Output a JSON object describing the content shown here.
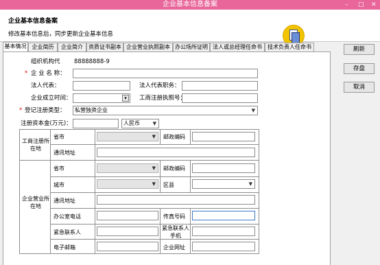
{
  "window": {
    "title": "企业基本信息备案",
    "controls": [
      "–",
      "□",
      "✕"
    ]
  },
  "header": {
    "title": "企业基本信息备案",
    "subtitle": "修改基本信息后，同步更新企业基本信息",
    "logo_icon": "documents-icon"
  },
  "tabs": [
    "基本情况",
    "企业简历",
    "企业简介",
    "资质证书副本",
    "企业营业执照副本",
    "办公场所证明",
    "法人或总经理任命书",
    "技术负责人任命书"
  ],
  "side_buttons": {
    "refresh": "刷新",
    "save": "存盘",
    "cancel": "取消"
  },
  "form": {
    "org_code_label": "组织机构代",
    "org_code_value": "88888888-9",
    "company_name_label": "企 业 名 称：",
    "legal_rep_label": "法人代表：",
    "legal_rep_title_label": "法人代表职务：",
    "founded_label": "企业成立时间：",
    "business_license_label": "工商注册执照号：",
    "reg_type_label": "登记注册类型：",
    "reg_type_value": "私营独资企业",
    "capital_label": "注册资本金(万元)：",
    "currency_value": "人民币",
    "required_mark": "*"
  },
  "grid": {
    "reg_address_label": "工商注册所在地",
    "biz_address_label": "企业营业所在地",
    "province_label": "省市",
    "postal_label": "邮政编码",
    "address_label": "通讯地址",
    "city_label": "城市",
    "county_label": "区县",
    "office_phone_label": "办公室电话",
    "fax_label": "传真号码",
    "emergency_contact_label": "紧急联系人",
    "emergency_mobile_label": "紧急联系人手机",
    "email_label": "电子邮箱",
    "website_label": "企业网址"
  },
  "colors": {
    "titlebar": "#e8669a",
    "logo": "#f2c400"
  }
}
